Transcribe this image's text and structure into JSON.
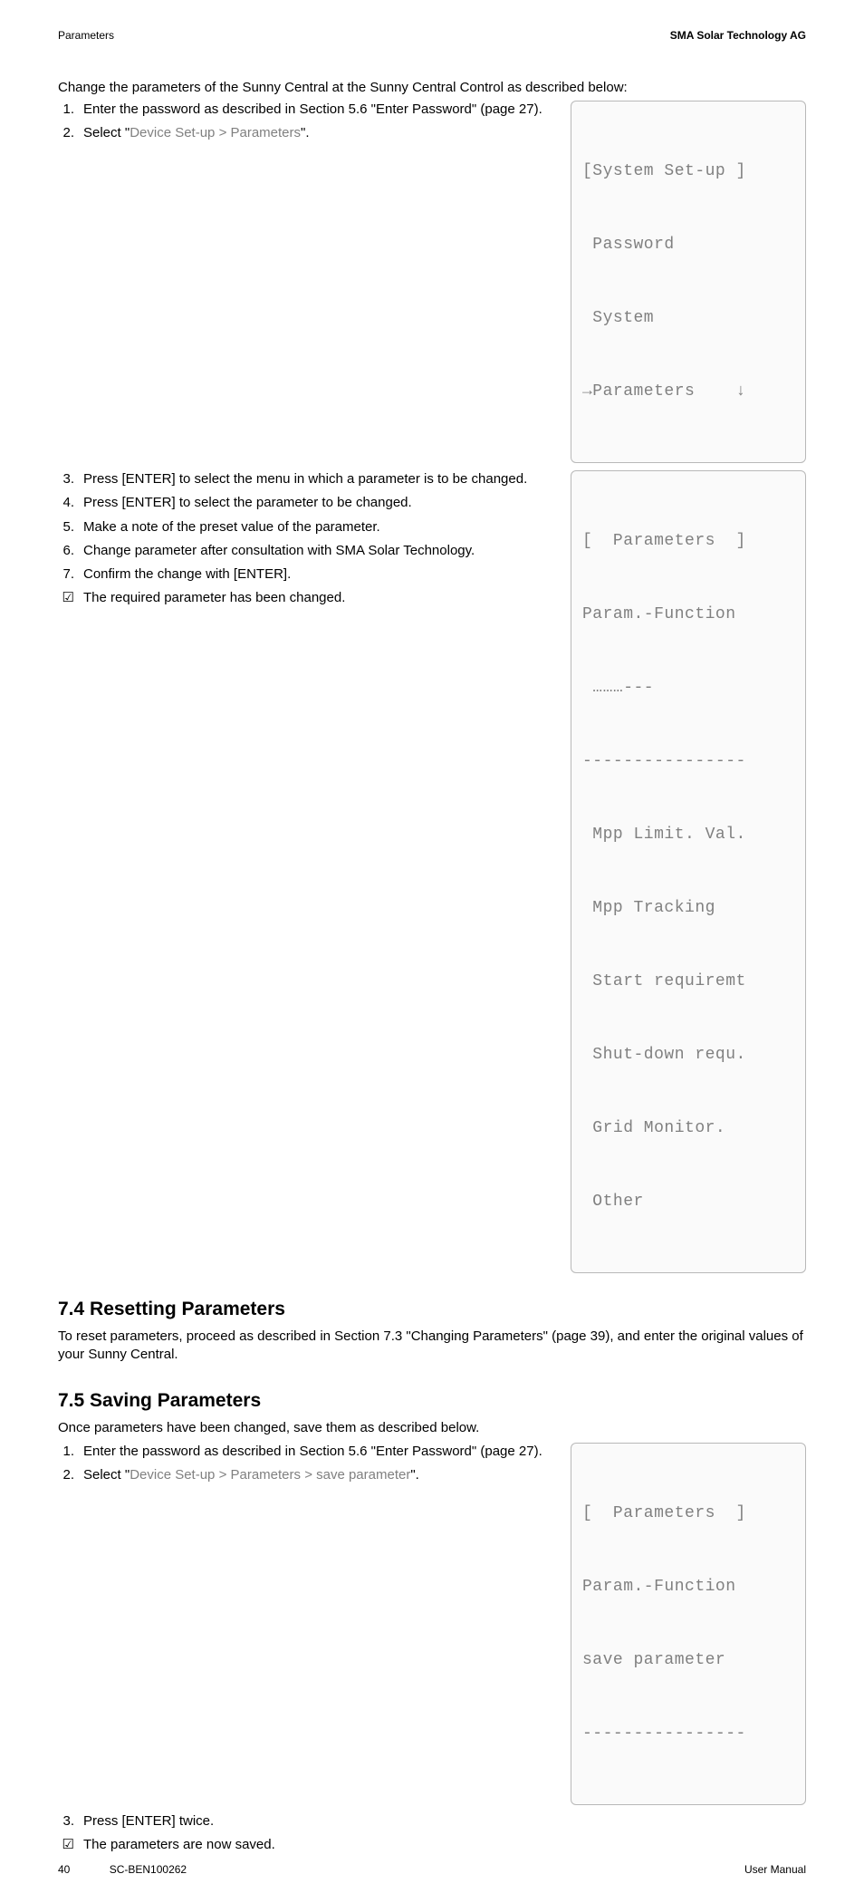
{
  "header": {
    "left": "Parameters",
    "right": "SMA Solar Technology AG"
  },
  "intro": "Change the parameters of the Sunny Central at the Sunny Central Control as described below:",
  "steps_a": [
    {
      "marker": "1.",
      "text_pre": "Enter the password as described in Section 5.6 \"Enter Password\" (page 27)."
    },
    {
      "marker": "2.",
      "text_pre": "Select \"",
      "grey": "Device Set-up > Parameters",
      "text_post": "\"."
    }
  ],
  "screen1": {
    "l1": "[System Set-up ]",
    "l2": " Password",
    "l3": " System",
    "l4": "→Parameters    ↓"
  },
  "steps_b": [
    {
      "marker": "3.",
      "text": "Press [ENTER] to select the menu in which a parameter is to be changed."
    },
    {
      "marker": "4.",
      "text": "Press [ENTER] to select the parameter to be changed."
    },
    {
      "marker": "5.",
      "text": "Make a note of the preset value of the parameter."
    },
    {
      "marker": "6.",
      "text": "Change parameter after consultation with SMA Solar Technology."
    },
    {
      "marker": "7.",
      "text": "Confirm the change with [ENTER]."
    },
    {
      "marker": "☑",
      "text": "The required parameter has been changed."
    }
  ],
  "screen2": {
    "l1": "[  Parameters  ]",
    "l2": "Param.-Function",
    "l3": " ………---",
    "l4": "----------------",
    "l5": " Mpp Limit. Val.",
    "l6": " Mpp Tracking",
    "l7": " Start requiremt",
    "l8": " Shut-down requ.",
    "l9": " Grid Monitor.",
    "l10": " Other"
  },
  "section74": {
    "heading": "7.4  Resetting Parameters",
    "body": "To reset parameters, proceed as described in Section 7.3 \"Changing Parameters\" (page 39), and enter the original values of your Sunny Central."
  },
  "section75": {
    "heading": "7.5  Saving Parameters",
    "body1": "Once parameters have been changed, save them as described below.",
    "step1": {
      "marker": "1.",
      "text": "Enter the password as described in Section 5.6 \"Enter Password\" (page 27)."
    },
    "step2": {
      "marker": "2.",
      "pre": "Select \"",
      "grey": "Device Set-up > Parameters > save parameter",
      "post": "\"."
    },
    "step3": {
      "marker": "3.",
      "text": "Press [ENTER] twice."
    },
    "step4": {
      "marker": "☑",
      "text": "The parameters are now saved."
    }
  },
  "screen3": {
    "l1": "[  Parameters  ]",
    "l2": "Param.-Function",
    "l3": "save parameter",
    "l4": "----------------"
  },
  "footer": {
    "page": "40",
    "code": "SC-BEN100262",
    "right": "User Manual"
  }
}
